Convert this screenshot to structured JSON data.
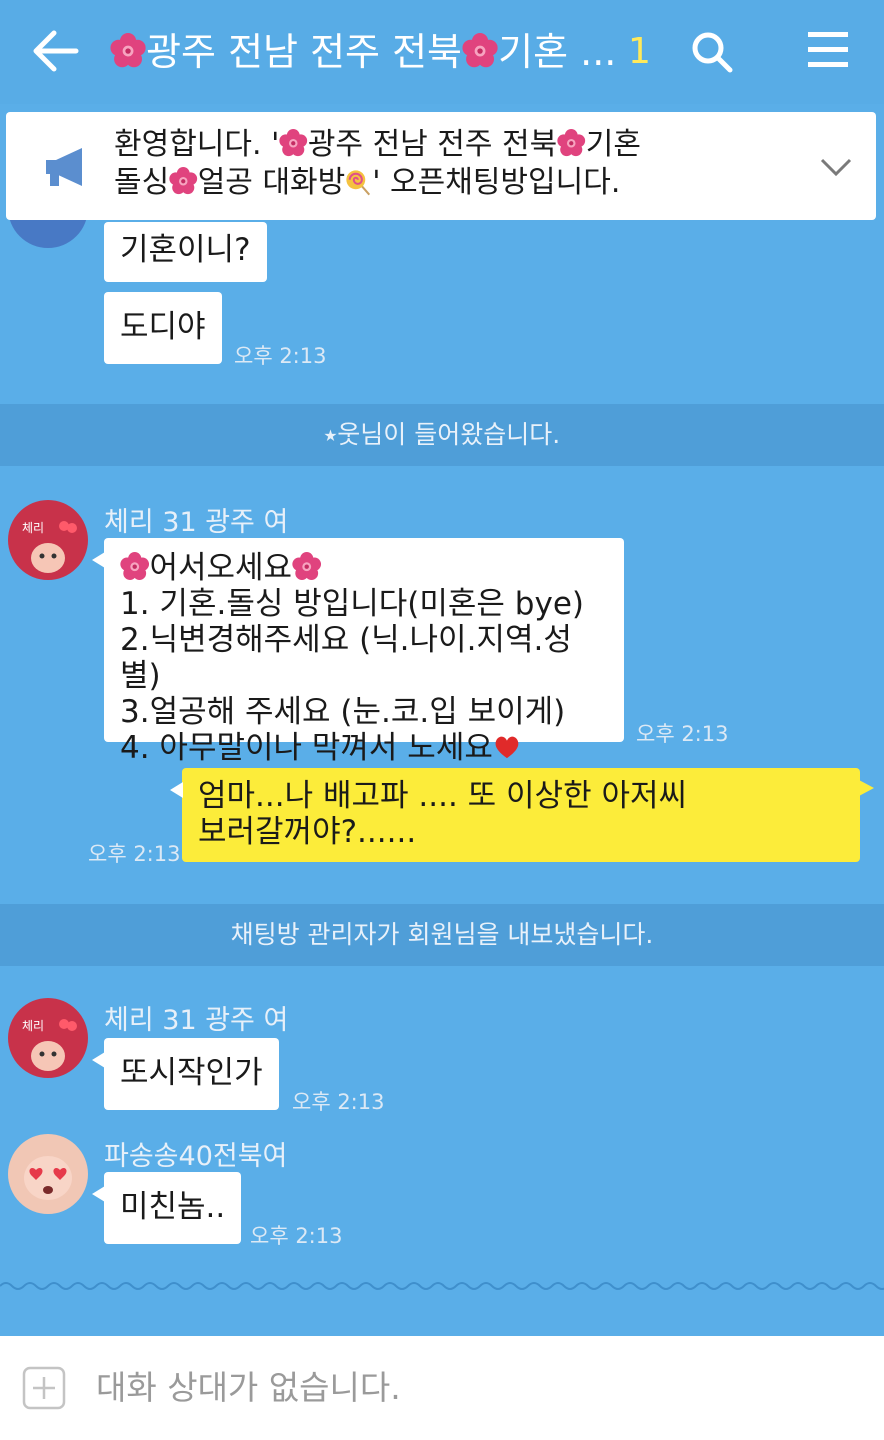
{
  "header": {
    "title": "광주 전남 전주 전북 기혼 ...",
    "title_parts": [
      "광주 전남 전주 전북",
      "기혼 ..."
    ],
    "member_count": "1",
    "back_icon": "arrow-left-icon",
    "search_icon": "search-icon",
    "menu_icon": "hamburger-menu-icon"
  },
  "notice": {
    "line1_a": "환영합니다. '",
    "line1_b": "광주 전남 전주 전북",
    "line1_c": "기혼",
    "line2_a": "돌싱",
    "line2_b": "얼공 대화방",
    "line2_c": "' 오픈채팅방입니다.",
    "icon": "megaphone-icon",
    "expand_icon": "chevron-down-icon"
  },
  "messages": {
    "m1": {
      "text": "기혼이니?"
    },
    "m2": {
      "text": "도디야",
      "time": "오후 2:13"
    },
    "sys1": "⭑웃님이 들어왔습니다.",
    "m3": {
      "sender": "체리 31 광주 여",
      "greeting": "어서오세요",
      "line1": "1. 기혼.돌싱 방입니다(미혼은 bye)",
      "line2": "2.닉변경해주세요 (닉.나이.지역.성별)",
      "line3": "3.얼공해 주세요 (눈.코.입 보이게)",
      "line4": "4. 아무말이나 막껴서 노세요",
      "time": "오후 2:13"
    },
    "m4": {
      "line1": "엄마...나 배고파 .... 또 이상한 아저씨",
      "line2": "보러갈꺼야?......",
      "time": "오후 2:13"
    },
    "sys2": "채팅방 관리자가 회원님을 내보냈습니다.",
    "m5": {
      "sender": "체리 31 광주 여",
      "text": "또시작인가",
      "time": "오후 2:13"
    },
    "m6": {
      "sender": "파송송40전북여",
      "text": "미친놈..",
      "time": "오후 2:13"
    }
  },
  "input": {
    "placeholder": "대화 상대가 없습니다.",
    "plus_icon": "plus-icon"
  },
  "colors": {
    "background": "#5aaee8",
    "my_bubble": "#fcec3a",
    "other_bubble": "#ffffff",
    "system_bar": "#4f9ed8",
    "flower": "#e0437e"
  }
}
